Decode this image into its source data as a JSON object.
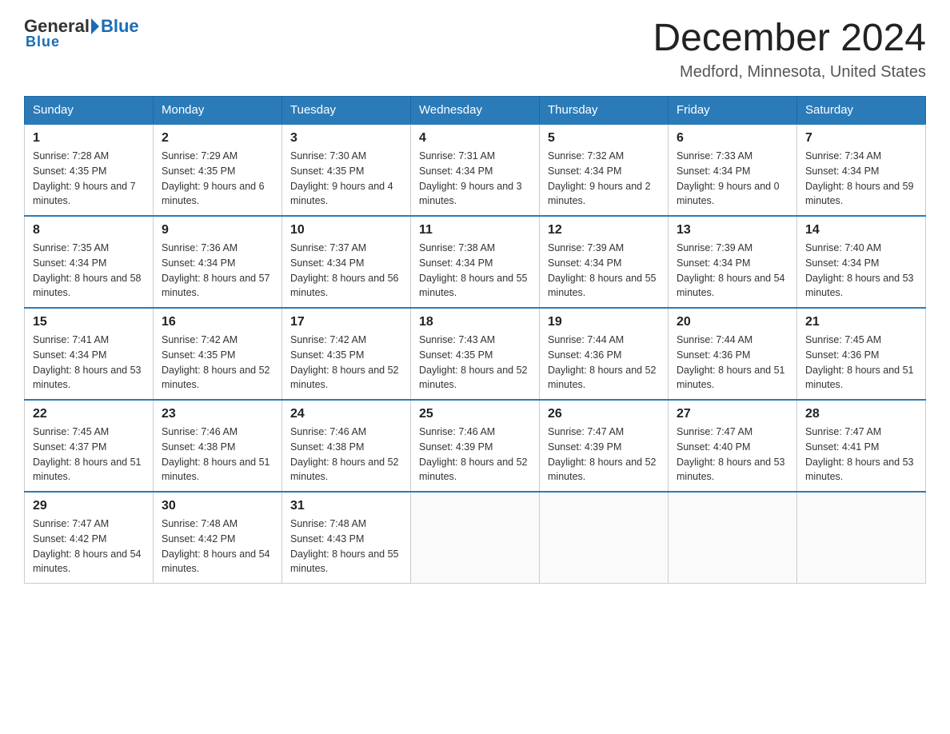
{
  "logo": {
    "general": "General",
    "blue": "Blue",
    "underline": "Blue"
  },
  "header": {
    "title": "December 2024",
    "subtitle": "Medford, Minnesota, United States"
  },
  "columns": [
    "Sunday",
    "Monday",
    "Tuesday",
    "Wednesday",
    "Thursday",
    "Friday",
    "Saturday"
  ],
  "weeks": [
    [
      {
        "day": "1",
        "sunrise": "7:28 AM",
        "sunset": "4:35 PM",
        "daylight": "9 hours and 7 minutes."
      },
      {
        "day": "2",
        "sunrise": "7:29 AM",
        "sunset": "4:35 PM",
        "daylight": "9 hours and 6 minutes."
      },
      {
        "day": "3",
        "sunrise": "7:30 AM",
        "sunset": "4:35 PM",
        "daylight": "9 hours and 4 minutes."
      },
      {
        "day": "4",
        "sunrise": "7:31 AM",
        "sunset": "4:34 PM",
        "daylight": "9 hours and 3 minutes."
      },
      {
        "day": "5",
        "sunrise": "7:32 AM",
        "sunset": "4:34 PM",
        "daylight": "9 hours and 2 minutes."
      },
      {
        "day": "6",
        "sunrise": "7:33 AM",
        "sunset": "4:34 PM",
        "daylight": "9 hours and 0 minutes."
      },
      {
        "day": "7",
        "sunrise": "7:34 AM",
        "sunset": "4:34 PM",
        "daylight": "8 hours and 59 minutes."
      }
    ],
    [
      {
        "day": "8",
        "sunrise": "7:35 AM",
        "sunset": "4:34 PM",
        "daylight": "8 hours and 58 minutes."
      },
      {
        "day": "9",
        "sunrise": "7:36 AM",
        "sunset": "4:34 PM",
        "daylight": "8 hours and 57 minutes."
      },
      {
        "day": "10",
        "sunrise": "7:37 AM",
        "sunset": "4:34 PM",
        "daylight": "8 hours and 56 minutes."
      },
      {
        "day": "11",
        "sunrise": "7:38 AM",
        "sunset": "4:34 PM",
        "daylight": "8 hours and 55 minutes."
      },
      {
        "day": "12",
        "sunrise": "7:39 AM",
        "sunset": "4:34 PM",
        "daylight": "8 hours and 55 minutes."
      },
      {
        "day": "13",
        "sunrise": "7:39 AM",
        "sunset": "4:34 PM",
        "daylight": "8 hours and 54 minutes."
      },
      {
        "day": "14",
        "sunrise": "7:40 AM",
        "sunset": "4:34 PM",
        "daylight": "8 hours and 53 minutes."
      }
    ],
    [
      {
        "day": "15",
        "sunrise": "7:41 AM",
        "sunset": "4:34 PM",
        "daylight": "8 hours and 53 minutes."
      },
      {
        "day": "16",
        "sunrise": "7:42 AM",
        "sunset": "4:35 PM",
        "daylight": "8 hours and 52 minutes."
      },
      {
        "day": "17",
        "sunrise": "7:42 AM",
        "sunset": "4:35 PM",
        "daylight": "8 hours and 52 minutes."
      },
      {
        "day": "18",
        "sunrise": "7:43 AM",
        "sunset": "4:35 PM",
        "daylight": "8 hours and 52 minutes."
      },
      {
        "day": "19",
        "sunrise": "7:44 AM",
        "sunset": "4:36 PM",
        "daylight": "8 hours and 52 minutes."
      },
      {
        "day": "20",
        "sunrise": "7:44 AM",
        "sunset": "4:36 PM",
        "daylight": "8 hours and 51 minutes."
      },
      {
        "day": "21",
        "sunrise": "7:45 AM",
        "sunset": "4:36 PM",
        "daylight": "8 hours and 51 minutes."
      }
    ],
    [
      {
        "day": "22",
        "sunrise": "7:45 AM",
        "sunset": "4:37 PM",
        "daylight": "8 hours and 51 minutes."
      },
      {
        "day": "23",
        "sunrise": "7:46 AM",
        "sunset": "4:38 PM",
        "daylight": "8 hours and 51 minutes."
      },
      {
        "day": "24",
        "sunrise": "7:46 AM",
        "sunset": "4:38 PM",
        "daylight": "8 hours and 52 minutes."
      },
      {
        "day": "25",
        "sunrise": "7:46 AM",
        "sunset": "4:39 PM",
        "daylight": "8 hours and 52 minutes."
      },
      {
        "day": "26",
        "sunrise": "7:47 AM",
        "sunset": "4:39 PM",
        "daylight": "8 hours and 52 minutes."
      },
      {
        "day": "27",
        "sunrise": "7:47 AM",
        "sunset": "4:40 PM",
        "daylight": "8 hours and 53 minutes."
      },
      {
        "day": "28",
        "sunrise": "7:47 AM",
        "sunset": "4:41 PM",
        "daylight": "8 hours and 53 minutes."
      }
    ],
    [
      {
        "day": "29",
        "sunrise": "7:47 AM",
        "sunset": "4:42 PM",
        "daylight": "8 hours and 54 minutes."
      },
      {
        "day": "30",
        "sunrise": "7:48 AM",
        "sunset": "4:42 PM",
        "daylight": "8 hours and 54 minutes."
      },
      {
        "day": "31",
        "sunrise": "7:48 AM",
        "sunset": "4:43 PM",
        "daylight": "8 hours and 55 minutes."
      },
      null,
      null,
      null,
      null
    ]
  ]
}
